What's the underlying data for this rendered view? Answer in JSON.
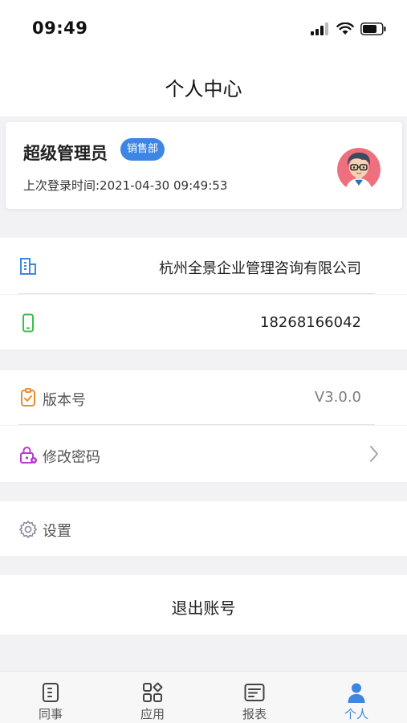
{
  "status_bar": {
    "time": "09:49",
    "icons": [
      "signal-icon",
      "wifi-icon",
      "battery-icon"
    ]
  },
  "header": {
    "title": "个人中心"
  },
  "profile": {
    "name": "超级管理员",
    "department": "销售部",
    "last_login": "上次登录时间:2021-04-30 09:49:53",
    "avatar_icon": "user-avatar-icon"
  },
  "info_rows": [
    {
      "icon": "building-icon",
      "value": "杭州全景企业管理咨询有限公司"
    },
    {
      "icon": "phone-icon",
      "value": "18268166042"
    }
  ],
  "app_rows": [
    {
      "icon": "version-icon",
      "label": "版本号",
      "value": "V3.0.0"
    },
    {
      "icon": "lock-icon",
      "label": "修改密码",
      "value": ""
    }
  ],
  "settings": {
    "icon": "gear-icon",
    "label": "设置"
  },
  "logout": {
    "label": "退出账号"
  },
  "tab_bar": {
    "tabs": [
      {
        "icon": "colleague-icon",
        "label": "同事",
        "active": false
      },
      {
        "icon": "apps-icon",
        "label": "应用",
        "active": false
      },
      {
        "icon": "report-icon",
        "label": "报表",
        "active": false
      },
      {
        "icon": "person-icon",
        "label": "个人",
        "active": true
      }
    ]
  },
  "colors": {
    "accent": "#3d86e4",
    "building_icon": "#3d86e4",
    "phone_icon": "#3dbf4a",
    "version_icon": "#f08a2e",
    "lock_icon": "#b43dcc",
    "background": "#f2f1f3"
  }
}
